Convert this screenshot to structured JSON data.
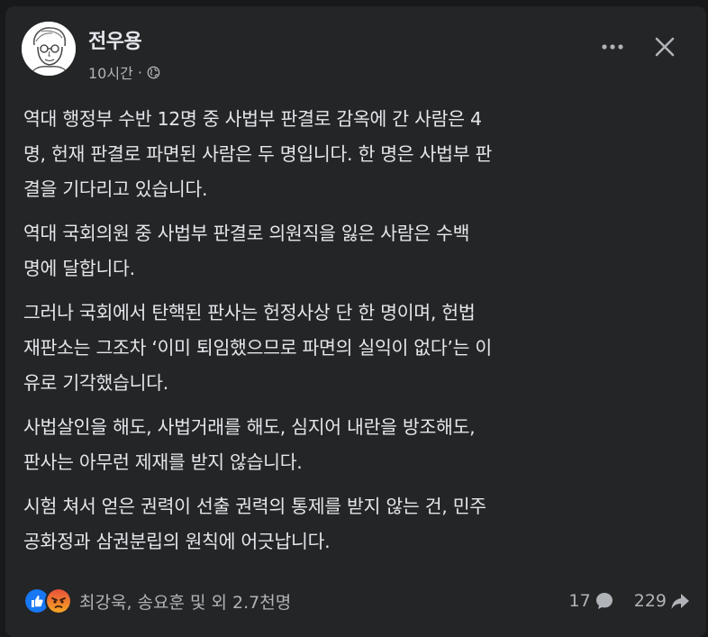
{
  "post": {
    "author": "전우용",
    "time": "10시간",
    "separator": "·",
    "privacy_icon": "globe-icon",
    "paragraphs": [
      "역대 행정부 수반 12명 중 사법부 판결로 감옥에 간 사람은 4\n명, 헌재 판결로 파면된 사람은 두 명입니다. 한 명은 사법부 판\n결을 기다리고 있습니다.",
      "역대 국회의원 중 사법부 판결로 의원직을 잃은 사람은 수백\n명에 달합니다.",
      "그러나 국회에서 탄핵된 판사는 헌정사상 단 한 명이며, 헌법\n재판소는 그조차 ‘이미 퇴임했으므로 파면의 실익이 없다’는 이\n유로 기각했습니다.",
      "사법살인을 해도, 사법거래를 해도, 심지어 내란을 방조해도,\n판사는 아무런 제재를 받지 않습니다.",
      "시험 쳐서 얻은 권력이 선출 권력의 통제를 받지 않는 건, 민주\n공화정과 삼권분립의 원칙에 어긋납니다."
    ]
  },
  "reactions": {
    "icons": [
      "like-icon",
      "angry-icon"
    ],
    "text": "최강욱, 송요훈 및 외 2.7천명",
    "comments": "17",
    "shares": "229"
  },
  "colors": {
    "background": "#18191a",
    "card": "#242526",
    "text_primary": "#e4e6eb",
    "text_secondary": "#b0b3b8",
    "like_blue": "#1877f2",
    "angry_start": "#f5a623",
    "angry_end": "#e9503a"
  }
}
